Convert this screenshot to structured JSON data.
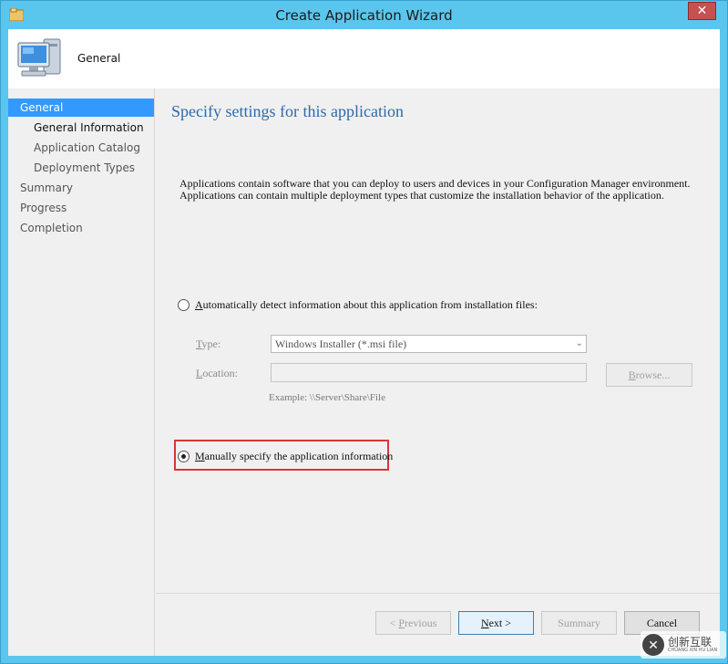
{
  "window": {
    "title": "Create Application Wizard",
    "close_label": "✕"
  },
  "header": {
    "title": "General",
    "icon": "computer-icon"
  },
  "sidebar": {
    "items": [
      {
        "label": "General",
        "active": true
      },
      {
        "label": "General Information"
      },
      {
        "label": "Application Catalog"
      },
      {
        "label": "Deployment Types"
      },
      {
        "label": "Summary"
      },
      {
        "label": "Progress"
      },
      {
        "label": "Completion"
      }
    ]
  },
  "main": {
    "title": "Specify settings for this application",
    "description_line1": "Applications contain software that you can deploy to users and devices in your Configuration Manager environment.",
    "description_line2": "Applications can contain multiple deployment types that customize the installation behavior of the application.",
    "auto_detect": {
      "label_first": "A",
      "label_rest": "utomatically detect information about this application from installation files:",
      "selected": false
    },
    "type": {
      "label_first": "T",
      "label_rest": "ype:",
      "value": "Windows Installer (*.msi file)"
    },
    "location": {
      "label_first": "L",
      "label_rest": "ocation:",
      "value": ""
    },
    "browse": {
      "label_first": "B",
      "label_rest": "rowse..."
    },
    "example": "Example: \\\\Server\\Share\\File",
    "manual": {
      "label_first": "M",
      "label_rest": "anually specify the application information",
      "selected": true
    }
  },
  "buttons": {
    "previous_prefix": "< ",
    "previous_first": "P",
    "previous_rest": "revious",
    "next_first": "N",
    "next_rest": "ext >",
    "summary": "Summary",
    "cancel": "Cancel"
  },
  "watermark": {
    "text": "创新互联",
    "sub": "CHUANG XIN HU LIAN"
  },
  "colors": {
    "accent": "#3399ff",
    "titlebar": "#5bc6ed",
    "highlight": "#d9353b",
    "heading": "#2e6aa8"
  }
}
